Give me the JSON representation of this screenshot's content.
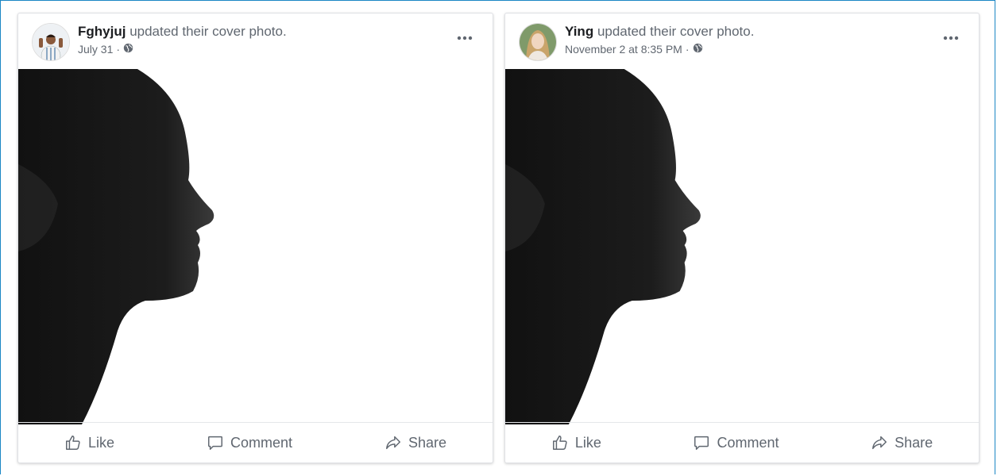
{
  "posts": [
    {
      "author": "Fghyjuj",
      "action": "updated their cover photo.",
      "timestamp": "July 31",
      "audience_icon": "globe-icon",
      "actions": {
        "like": "Like",
        "comment": "Comment",
        "share": "Share"
      }
    },
    {
      "author": "Ying",
      "action": "updated their cover photo.",
      "timestamp": "November 2 at 8:35 PM",
      "audience_icon": "globe-icon",
      "actions": {
        "like": "Like",
        "comment": "Comment",
        "share": "Share"
      }
    }
  ],
  "separator": "·",
  "colors": {
    "frame": "#1b86c4",
    "text_primary": "#1c1e21",
    "text_secondary": "#606770",
    "border": "#dfe1e5"
  }
}
